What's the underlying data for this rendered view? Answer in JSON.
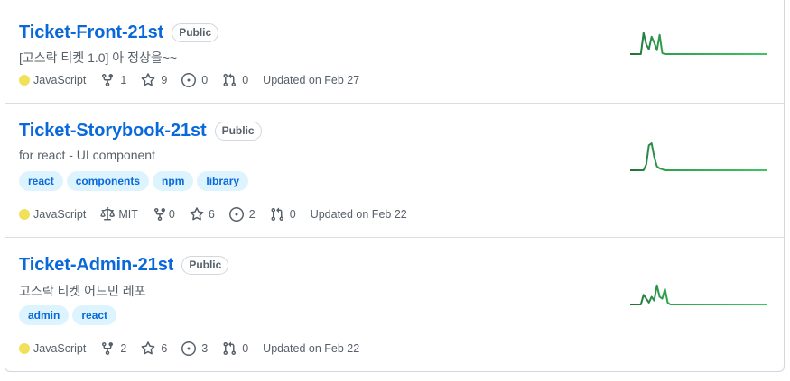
{
  "colors": {
    "link": "#0969da",
    "muted": "#57606a",
    "javascript": "#f1e05a",
    "spark": "#40c463"
  },
  "repos": [
    {
      "name": "Ticket-Front-21st",
      "visibility": "Public",
      "description": "[고스락 티켓 1.0] 아 정상을~~",
      "topics": [],
      "language": "JavaScript",
      "license": "",
      "forks": "1",
      "stars": "9",
      "issues": "0",
      "pulls": "0",
      "updated": "Updated on Feb 27",
      "activity": [
        0,
        0,
        0,
        0,
        0,
        22,
        10,
        5,
        18,
        12,
        4,
        20,
        1,
        0,
        0,
        0,
        0,
        0,
        0,
        0,
        0,
        0,
        0,
        0,
        0,
        0,
        0,
        0,
        0,
        0,
        0,
        0,
        0,
        0,
        0,
        0,
        0,
        0,
        0,
        0,
        0,
        0,
        0,
        0,
        0,
        0,
        0,
        0,
        0,
        0,
        0,
        0
      ]
    },
    {
      "name": "Ticket-Storybook-21st",
      "visibility": "Public",
      "description": "for react - UI component",
      "topics": [
        "react",
        "components",
        "npm",
        "library"
      ],
      "language": "JavaScript",
      "license": "MIT",
      "forks": "0",
      "stars": "6",
      "issues": "2",
      "pulls": "0",
      "updated": "Updated on Feb 22",
      "activity": [
        0,
        0,
        0,
        0,
        0,
        0,
        6,
        26,
        28,
        14,
        4,
        2,
        1,
        0,
        0,
        0,
        0,
        0,
        0,
        0,
        0,
        0,
        0,
        0,
        0,
        0,
        0,
        0,
        0,
        0,
        0,
        0,
        0,
        0,
        0,
        0,
        0,
        0,
        0,
        0,
        0,
        0,
        0,
        0,
        0,
        0,
        0,
        0,
        0,
        0,
        0,
        0
      ]
    },
    {
      "name": "Ticket-Admin-21st",
      "visibility": "Public",
      "description": "고스락 티켓 어드민 레포",
      "topics": [
        "admin",
        "react"
      ],
      "language": "JavaScript",
      "license": "",
      "forks": "2",
      "stars": "6",
      "issues": "3",
      "pulls": "0",
      "updated": "Updated on Feb 22",
      "activity": [
        0,
        0,
        0,
        0,
        0,
        10,
        6,
        2,
        8,
        4,
        20,
        8,
        6,
        16,
        2,
        0,
        0,
        0,
        0,
        0,
        0,
        0,
        0,
        0,
        0,
        0,
        0,
        0,
        0,
        0,
        0,
        0,
        0,
        0,
        0,
        0,
        0,
        0,
        0,
        0,
        0,
        0,
        0,
        0,
        0,
        0,
        0,
        0,
        0,
        0,
        0,
        0
      ]
    }
  ]
}
